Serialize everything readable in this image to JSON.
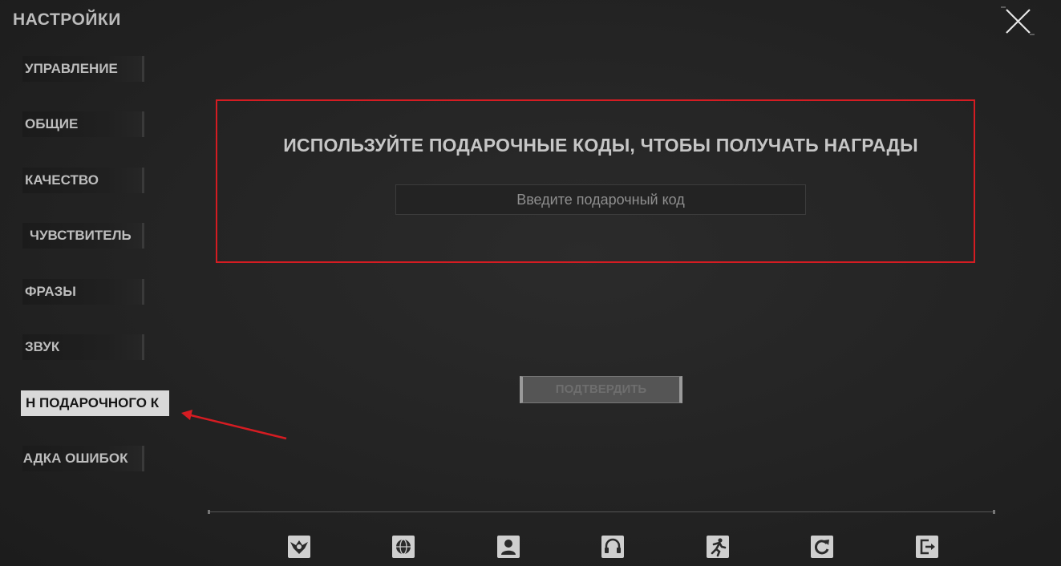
{
  "header": {
    "title": "НАСТРОЙКИ"
  },
  "sidebar": {
    "items": [
      {
        "label": "УПРАВЛЕНИЕ"
      },
      {
        "label": "ОБЩИЕ"
      },
      {
        "label": "КАЧЕСТВО"
      },
      {
        "label": "ЧУВСТВИТЕЛЬ"
      },
      {
        "label": "ФРАЗЫ"
      },
      {
        "label": "ЗВУК"
      },
      {
        "label": "Н ПОДАРОЧНОГО К"
      },
      {
        "label": "ІАДКА ОШИБОК"
      }
    ],
    "active_index": 6
  },
  "gift": {
    "heading": "ИСПОЛЬЗУЙТЕ ПОДАРОЧНЫЕ КОДЫ, ЧТОБЫ ПОЛУЧАТЬ НАГРАДЫ",
    "input_placeholder": "Введите подарочный код",
    "input_value": "",
    "confirm_label": "ПОДТВЕРДИТЬ"
  },
  "bottom_bar": {
    "icons": [
      "emblem-icon",
      "globe-icon",
      "user-icon",
      "headset-icon",
      "runner-icon",
      "refresh-icon",
      "exit-icon"
    ]
  },
  "colors": {
    "highlight_border": "#d51c22",
    "annotation_arrow": "#d51c22",
    "background": "#262626",
    "active_tab_bg": "#d9d9d9"
  }
}
